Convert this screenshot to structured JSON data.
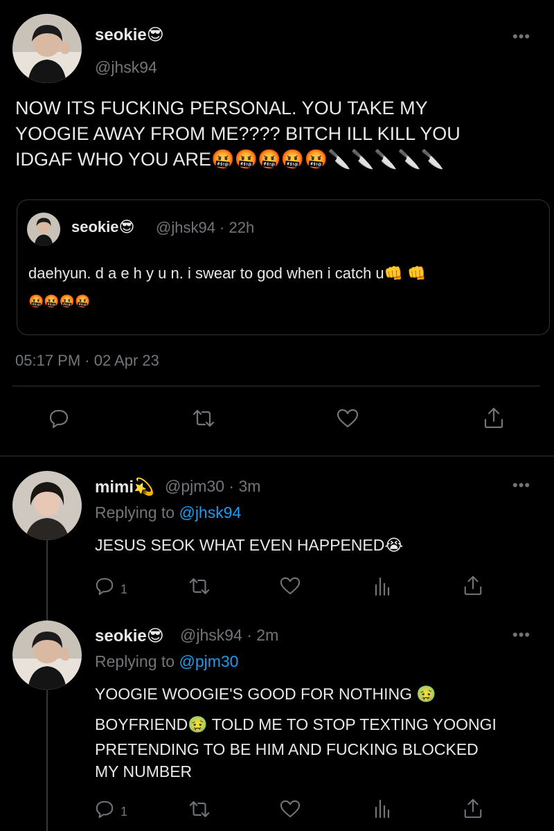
{
  "main_tweet": {
    "author_name": "seokie",
    "author_emoji": "😎",
    "handle": "@jhsk94",
    "more_label": "•••",
    "text_lines": [
      "NOW ITS FUCKING PERSONAL. YOU TAKE MY",
      "YOOGIE AWAY FROM ME???? BITCH ILL KILL YOU",
      "IDGAF WHO YOU ARE🤬🤬🤬🤬🤬🔪🔪🔪🔪🔪"
    ],
    "quoted": {
      "author_name": "seokie",
      "author_emoji": "😎",
      "handle_time": "@jhsk94 · 22h",
      "text_line1": "daehyun. d a e h y u n. i swear to god when i catch u👊 👊",
      "text_line2": "🤬🤬🤬🤬"
    },
    "timestamp": "05:17 PM · 02 Apr 23",
    "actions": [
      "reply-icon",
      "retweet-icon",
      "like-icon",
      "share-icon"
    ]
  },
  "replies": [
    {
      "author_name": "mimi",
      "author_emoji": "💫",
      "handle": "@pjm30",
      "time": "· 3m",
      "replying_prefix": "Replying to ",
      "replying_handle": "@jhsk94",
      "text_lines": [
        "JESUS SEOK WHAT EVEN HAPPENED😭"
      ],
      "reply_count": "1",
      "more_label": "•••"
    },
    {
      "author_name": "seokie",
      "author_emoji": "😎",
      "handle": "@jhsk94",
      "time": "· 2m",
      "replying_prefix": "Replying to ",
      "replying_handle": "@pjm30",
      "text_lines": [
        "YOOGIE WOOGIE'S GOOD FOR NOTHING 🤢",
        "BOYFRIEND🤢  TOLD ME TO STOP TEXTING YOONGI",
        "PRETENDING TO BE HIM AND FUCKING BLOCKED",
        "MY NUMBER"
      ],
      "reply_count": "1",
      "more_label": "•••"
    }
  ],
  "colors": {
    "background": "#000000",
    "text": "#e7e9ea",
    "muted": "#71767b",
    "link": "#1d9bf0",
    "divider": "#2f3336"
  }
}
